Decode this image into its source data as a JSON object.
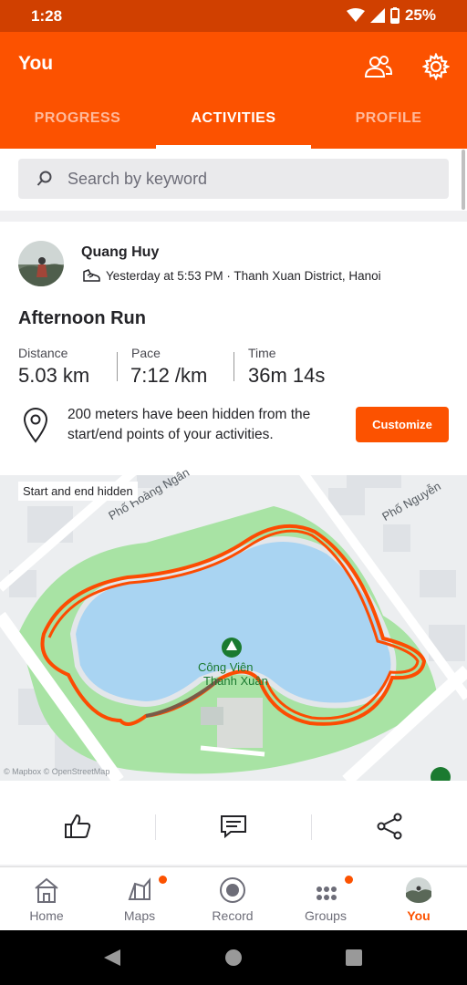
{
  "status_bar": {
    "time": "1:28",
    "battery": "25%"
  },
  "header": {
    "title": "You",
    "tabs": [
      "PROGRESS",
      "ACTIVITIES",
      "PROFILE"
    ]
  },
  "search": {
    "placeholder": "Search by keyword"
  },
  "activity": {
    "athlete": "Quang Huy",
    "meta": "Yesterday at 5:53 PM · Thanh Xuan District, Hanoi",
    "title": "Afternoon Run",
    "stats": [
      {
        "label": "Distance",
        "value": "5.03 km"
      },
      {
        "label": "Pace",
        "value": "7:12 /km"
      },
      {
        "label": "Time",
        "value": "36m 14s"
      }
    ],
    "privacy_notice": "200 meters have been hidden from the start/end points of your activities.",
    "customize_label": "Customize",
    "map": {
      "hidden_label": "Start and end hidden",
      "street_1": "Phố Hoàng Ngân",
      "street_2": "Phố Nguyễn",
      "park_name_1": "Công Viên",
      "park_name_2": "Thanh Xuân",
      "attribution": "© Mapbox © OpenStreetMap"
    }
  },
  "bottom_nav": {
    "items": [
      {
        "label": "Home",
        "icon": "home-icon"
      },
      {
        "label": "Maps",
        "icon": "map-icon"
      },
      {
        "label": "Record",
        "icon": "record-icon"
      },
      {
        "label": "Groups",
        "icon": "groups-icon"
      },
      {
        "label": "You",
        "icon": "avatar"
      }
    ]
  },
  "colors": {
    "brand": "#fc5200",
    "status_bar": "#d04000",
    "route": "#fc4c02",
    "water": "#a9d4f2",
    "park": "#a8e3a4"
  }
}
